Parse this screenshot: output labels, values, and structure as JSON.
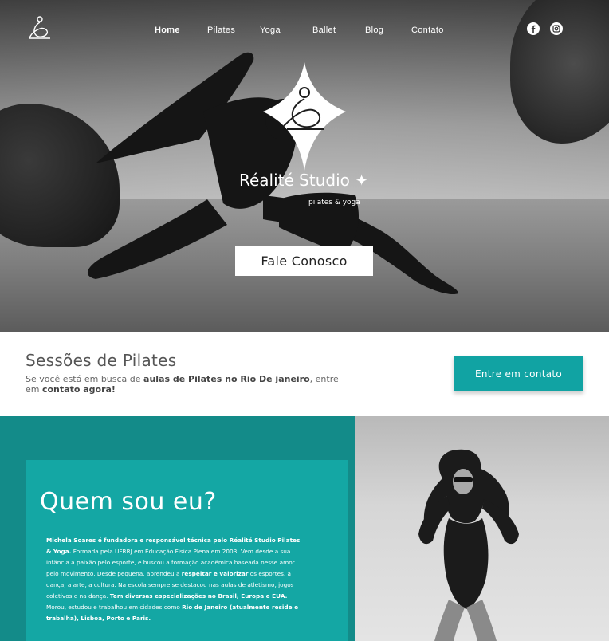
{
  "nav": {
    "items": [
      {
        "label": "Home",
        "active": true
      },
      {
        "label": "Pilates"
      },
      {
        "label": "Yoga"
      },
      {
        "label": "Ballet"
      },
      {
        "label": "Blog"
      },
      {
        "label": "Contato"
      }
    ],
    "social": [
      {
        "icon": "facebook-icon"
      },
      {
        "icon": "instagram-icon"
      }
    ]
  },
  "hero": {
    "brand_name": "Réalité Studio ✦",
    "brand_tagline": "pilates & yoga",
    "cta_label": "Fale Conosco"
  },
  "sessions": {
    "title": "Sessões de Pilates",
    "text_1": "Se você está em busca de ",
    "text_bold_1": "aulas de Pilates no Rio De janeiro",
    "text_2": ", entre em ",
    "text_bold_2": "contato agora!",
    "cta_label": "Entre em contato"
  },
  "about": {
    "title": "Quem sou eu?",
    "p_bold_1": "Michela Soares é fundadora e responsável técnica pelo Réalité Studio Pilates & Yoga.",
    "p_1": " Formada pela UFRRJ em Educação Física Plena em 2003. Vem desde a sua infância a paixão pelo esporte, e buscou a formação acadêmica baseada nesse amor pelo movimento. Desde pequena, aprendeu a ",
    "p_bold_2": "respeitar e valorizar",
    "p_2": " os esportes, a dança, a arte, a cultura. Na escola sempre se destacou nas aulas de atletismo, jogos coletivos e na dança. ",
    "p_bold_3": "Tem diversas especializações no Brasil, Europa e EUA.",
    "p_3": " Morou, estudou e trabalhou em cidades como ",
    "p_bold_4": "Rio de Janeiro (atualmente reside e trabalha), Lisboa, Porto e Paris."
  },
  "colors": {
    "accent": "#14a7a4",
    "accent_dark": "#138b89",
    "button": "#11a3a3"
  }
}
